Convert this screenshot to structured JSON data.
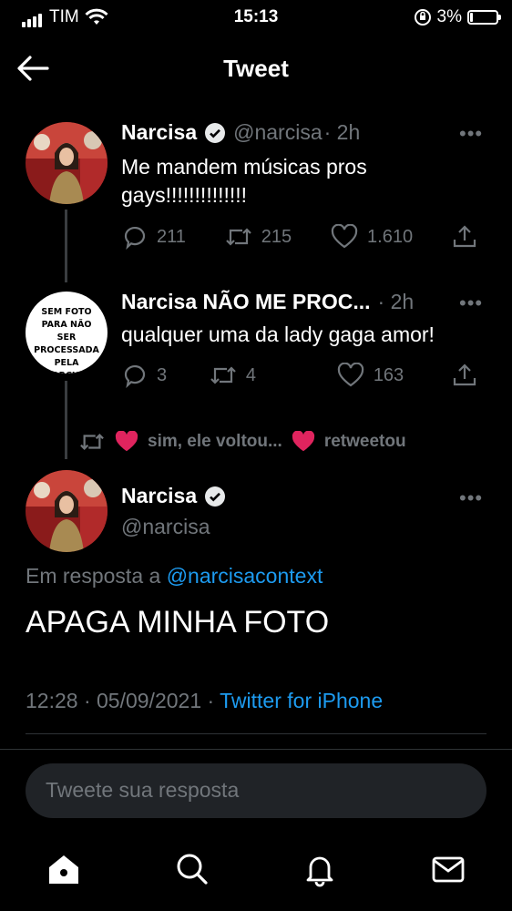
{
  "status": {
    "carrier": "TIM",
    "time": "15:13",
    "battery": "3%"
  },
  "header": {
    "title": "Tweet"
  },
  "thread": [
    {
      "name": "Narcisa",
      "handle": "@narcisa",
      "time": "· 2h",
      "text": "Me mandem músicas pros gays!!!!!!!!!!!!!!",
      "replies": "211",
      "retweets": "215",
      "likes": "1.610",
      "verified": true
    },
    {
      "name": "Narcisa NÃO ME PROC...",
      "time": "· 2h",
      "avatar_text": "SEM FOTO PARA NÃO SER PROCESSADA PELA NARCISA",
      "text": "qualquer uma da lady gaga amor!",
      "replies": "3",
      "retweets": "4",
      "likes": "163"
    }
  ],
  "retweet_banner": {
    "user": "sim, ele voltou...",
    "action": "retweetou"
  },
  "main_tweet": {
    "name": "Narcisa",
    "handle": "@narcisa",
    "reply_prefix": "Em resposta a",
    "reply_to": "@narcisacontext",
    "text": "APAGA MINHA FOTO",
    "timestamp": "12:28 · 05/09/2021 ·",
    "source": "Twitter for iPhone"
  },
  "reply_input": {
    "placeholder": "Tweete sua resposta"
  },
  "nav": {
    "icons": [
      "home-icon",
      "search-icon",
      "notifications-icon",
      "messages-icon"
    ]
  },
  "colors": {
    "accent": "#1d9bf0",
    "secondary": "#71767b",
    "heart": "#e0245e"
  }
}
